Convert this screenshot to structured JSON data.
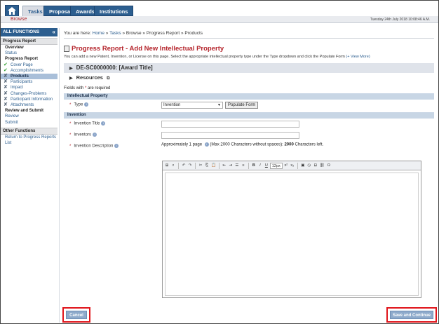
{
  "nav": {
    "tabs": [
      "Tasks",
      "Proposals",
      "Awards",
      "Institutions"
    ],
    "subnav": "Browse",
    "datetime": "Tuesday 24th July 2018 10:08:46 A.M."
  },
  "sidebar": {
    "header": "ALL FUNCTIONS",
    "collapse_glyph": "«",
    "section1": "Progress Report",
    "items": [
      {
        "label": "Overview",
        "style": "bold",
        "mark": ""
      },
      {
        "label": "Status",
        "style": "link",
        "mark": ""
      },
      {
        "label": "Progress Report",
        "style": "bold",
        "mark": ""
      },
      {
        "label": "Cover Page",
        "style": "link",
        "mark": "ok"
      },
      {
        "label": "Accomplishments",
        "style": "link",
        "mark": "ok"
      },
      {
        "label": "Products",
        "style": "selected",
        "mark": "x"
      },
      {
        "label": "Participants",
        "style": "link",
        "mark": "x"
      },
      {
        "label": "Impact",
        "style": "link",
        "mark": "x"
      },
      {
        "label": "Changes-Problems",
        "style": "link",
        "mark": "x"
      },
      {
        "label": "Participant Information",
        "style": "link",
        "mark": "x"
      },
      {
        "label": "Attachments",
        "style": "link",
        "mark": "x"
      },
      {
        "label": "Review and Submit",
        "style": "bold",
        "mark": ""
      },
      {
        "label": "Review",
        "style": "link",
        "mark": ""
      },
      {
        "label": "Submit",
        "style": "link",
        "mark": ""
      }
    ],
    "section2": "Other Functions",
    "other_items": [
      "Return to Progress Reports",
      "List"
    ]
  },
  "main": {
    "breadcrumb_prefix": "You are here:",
    "breadcrumb": [
      "Home",
      "Tasks",
      "Browse",
      "Progress Report",
      "Products"
    ],
    "title": "Progress Report - Add New Intellectual Property",
    "intro": "You can add a new Patent, Invention, or License on this page. Select the appropriate intellectual property type under the Type dropdown and click the Populate Form",
    "view_more": "(+ View More)",
    "award": "DE-SC0000000: [Award Title]",
    "resources": "Resources",
    "required_note_pre": "Fields with",
    "required_note_post": "are required",
    "section_ip": "Intellectual Property",
    "type_label": "Type",
    "type_value": "Invention",
    "populate_button": "Populate Form",
    "section_invention": "Invention",
    "invention_title_label": "Invention Title",
    "inventors_label": "Inventors",
    "description_label": "Invention Description",
    "approx_pre": "Approximately 1 page",
    "approx_mid": "(Max 2000 Characters without spaces):",
    "approx_count": "2000",
    "approx_post": "Characters left.",
    "font_size": "12px"
  },
  "footer": {
    "cancel": "Cancel",
    "save": "Save and Continue"
  }
}
